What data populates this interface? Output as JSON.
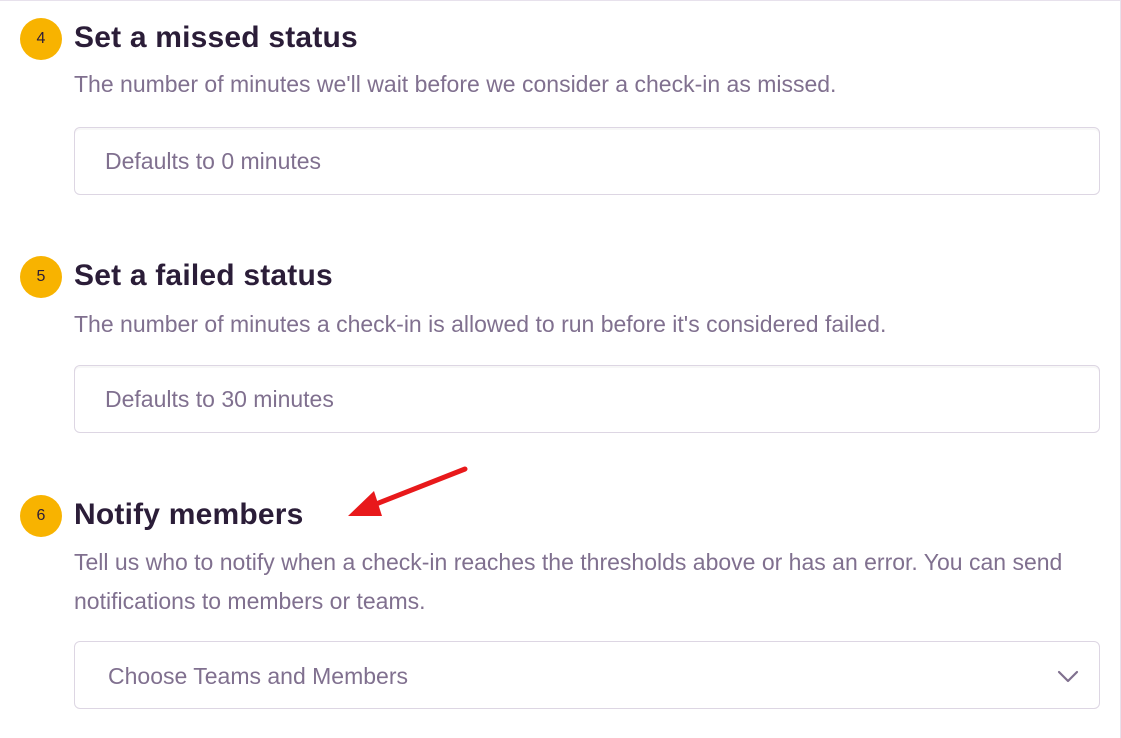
{
  "steps": [
    {
      "number": "4",
      "title": "Set a missed status",
      "description": "The number of minutes we'll wait before we consider a check-in as missed.",
      "input_placeholder": "Defaults to 0 minutes",
      "input_value": ""
    },
    {
      "number": "5",
      "title": "Set a failed status",
      "description": "The number of minutes a check-in is allowed to run before it's considered failed.",
      "input_placeholder": "Defaults to 30 minutes",
      "input_value": ""
    },
    {
      "number": "6",
      "title": "Notify members",
      "description": "Tell us who to notify when a check-in reaches the thresholds above or has an error. You can send notifications to members or teams.",
      "select_placeholder": "Choose Teams and Members"
    }
  ],
  "icons": {
    "select_chevron": "chevron-down-icon",
    "annotation": "red-arrow-icon"
  },
  "colors": {
    "badge": "#f8b300",
    "title": "#2b1d38",
    "description": "#80708f",
    "annotation_arrow": "#e8191b"
  }
}
